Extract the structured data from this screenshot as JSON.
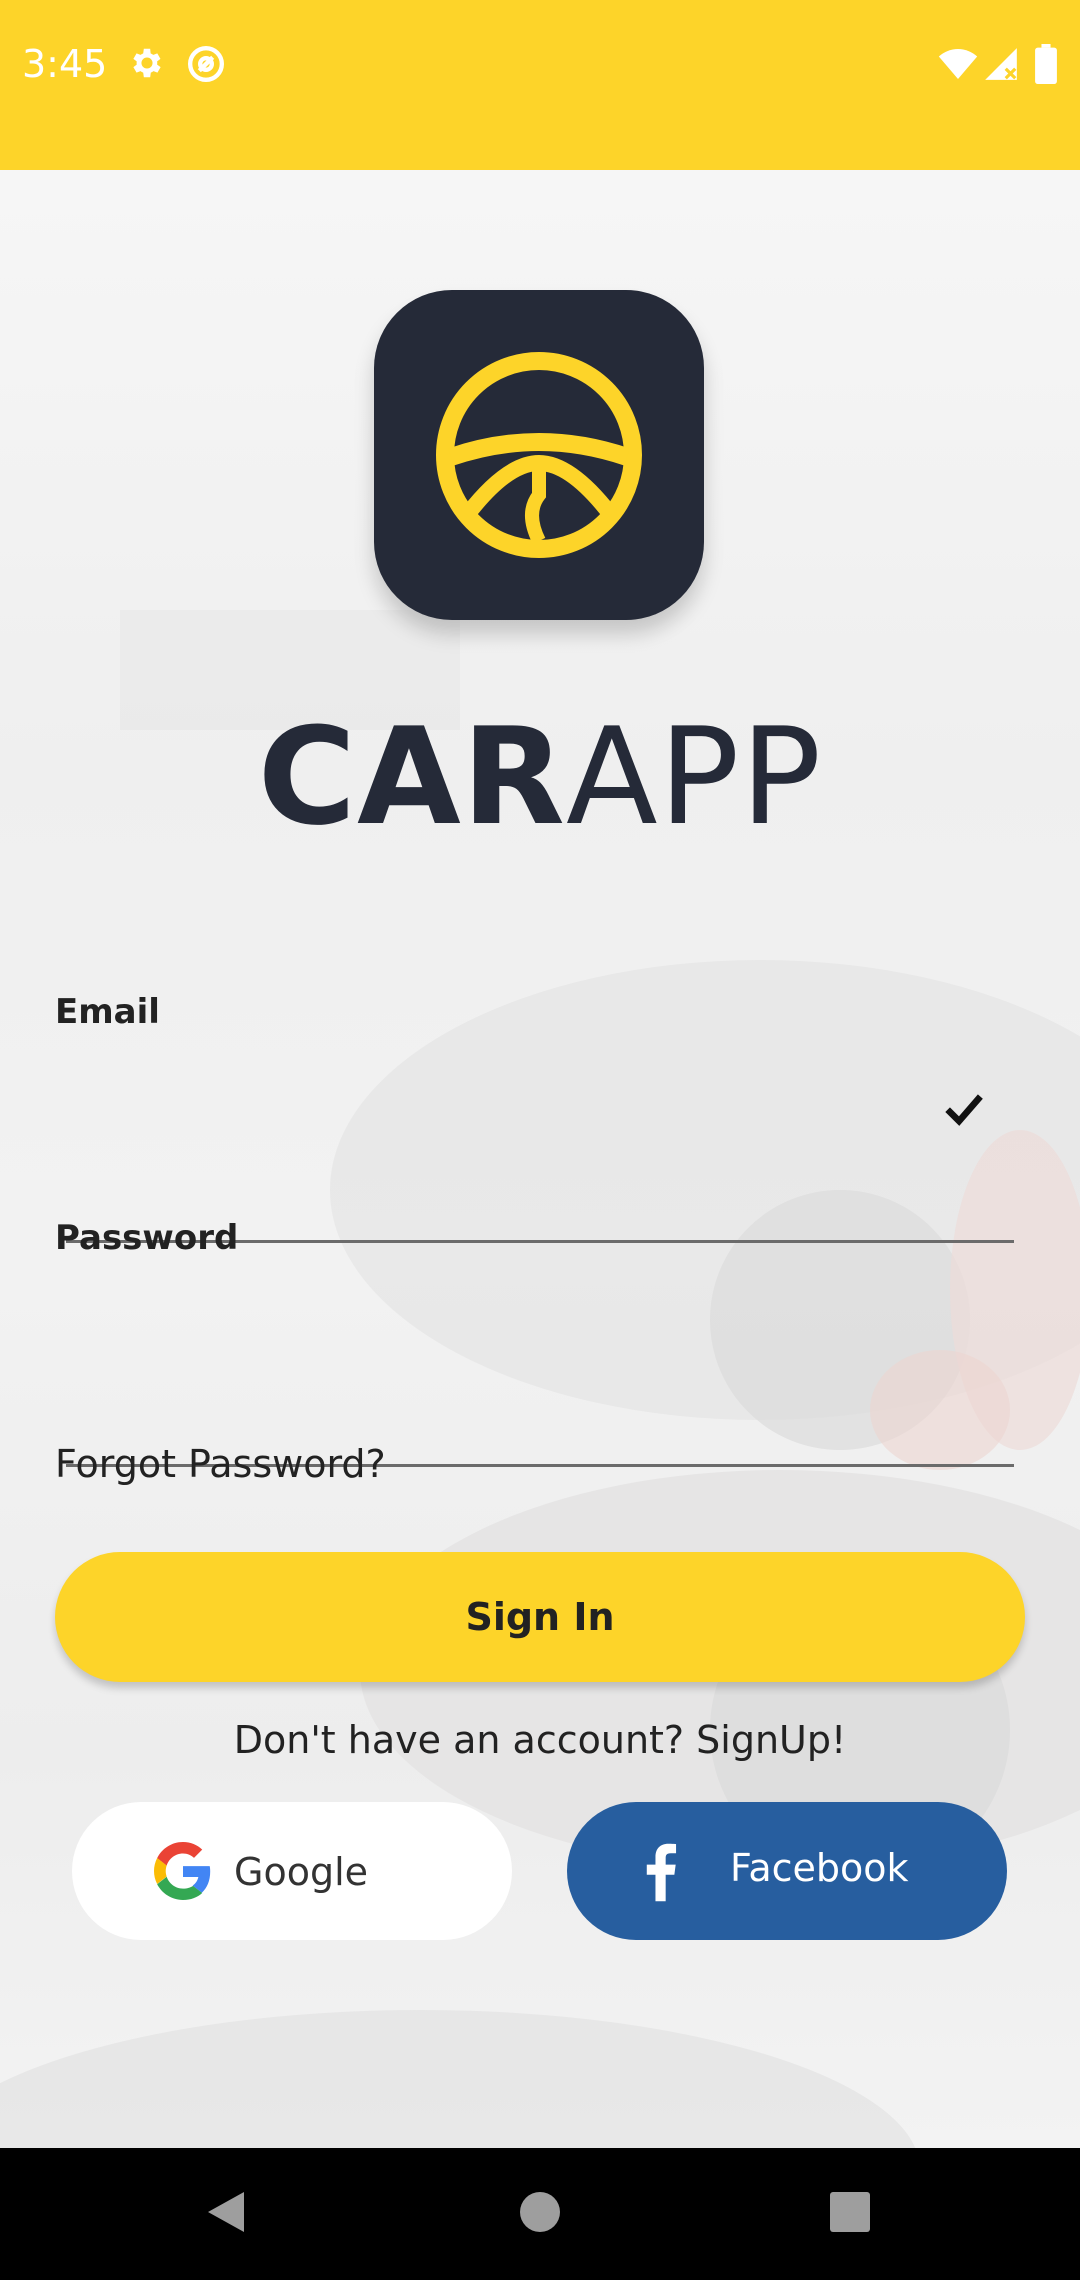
{
  "status_bar": {
    "time": "3:45",
    "background_color": "#fdd429",
    "icons": [
      "gear-icon",
      "at-sign-icon",
      "wifi-icon",
      "cell-signal-icon",
      "battery-icon"
    ]
  },
  "brand": {
    "name_bold": "CAR",
    "name_light": "APP",
    "logo_icon": "steering-wheel-icon",
    "logo_bg_color": "#252a38",
    "logo_fg_color": "#fdd429"
  },
  "form": {
    "email_label": "Email",
    "email_value": "",
    "email_valid_icon": "checkmark-icon",
    "password_label": "Password",
    "password_value": "",
    "forgot_password": "Forgot Password?",
    "sign_in_label": "Sign In",
    "signup_prompt": "Don't have an account? SignUp!"
  },
  "social": {
    "google_label": "Google",
    "facebook_label": "Facebook",
    "facebook_color": "#275e9f"
  },
  "nav_bar": {
    "buttons": [
      "back-icon",
      "home-icon",
      "recents-icon"
    ]
  }
}
